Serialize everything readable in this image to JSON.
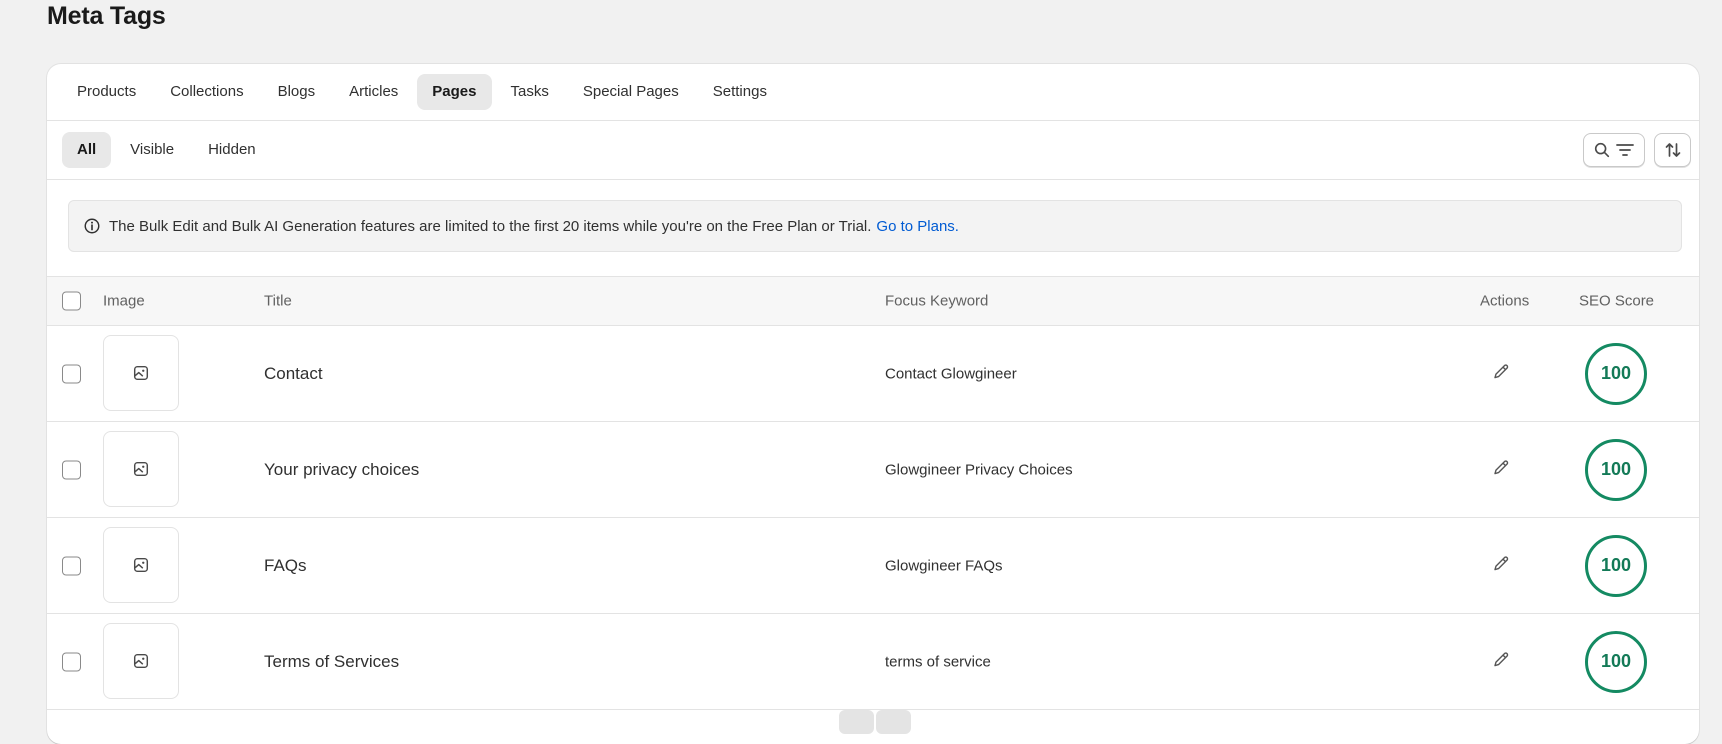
{
  "page_title": "Meta Tags",
  "tabs": [
    {
      "label": "Products"
    },
    {
      "label": "Collections"
    },
    {
      "label": "Blogs"
    },
    {
      "label": "Articles"
    },
    {
      "label": "Pages",
      "active": true
    },
    {
      "label": "Tasks"
    },
    {
      "label": "Special Pages"
    },
    {
      "label": "Settings"
    }
  ],
  "filters": [
    {
      "label": "All",
      "active": true
    },
    {
      "label": "Visible"
    },
    {
      "label": "Hidden"
    }
  ],
  "toolbar": {
    "search_icon": "search-icon",
    "filter_icon": "filter-lines-icon",
    "sort_icon": "sort-arrows-icon"
  },
  "banner": {
    "icon": "info-icon",
    "text": "The Bulk Edit and Bulk AI Generation features are limited to the first 20 items while you're on the Free Plan or Trial.",
    "link": "Go to Plans."
  },
  "table": {
    "headers": {
      "image": "Image",
      "title": "Title",
      "keyword": "Focus Keyword",
      "actions": "Actions",
      "score": "SEO Score"
    },
    "rows": [
      {
        "title": "Contact",
        "keyword": "Contact Glowgineer",
        "score": "100"
      },
      {
        "title": "Your privacy choices",
        "keyword": "Glowgineer Privacy Choices",
        "score": "100"
      },
      {
        "title": "FAQs",
        "keyword": "Glowgineer FAQs",
        "score": "100"
      },
      {
        "title": "Terms of Services",
        "keyword": "terms of service",
        "score": "100"
      }
    ]
  },
  "colors": {
    "score_ring": "#148a62",
    "link": "#005bd3",
    "active_tab_bg": "#e8e8e8"
  }
}
